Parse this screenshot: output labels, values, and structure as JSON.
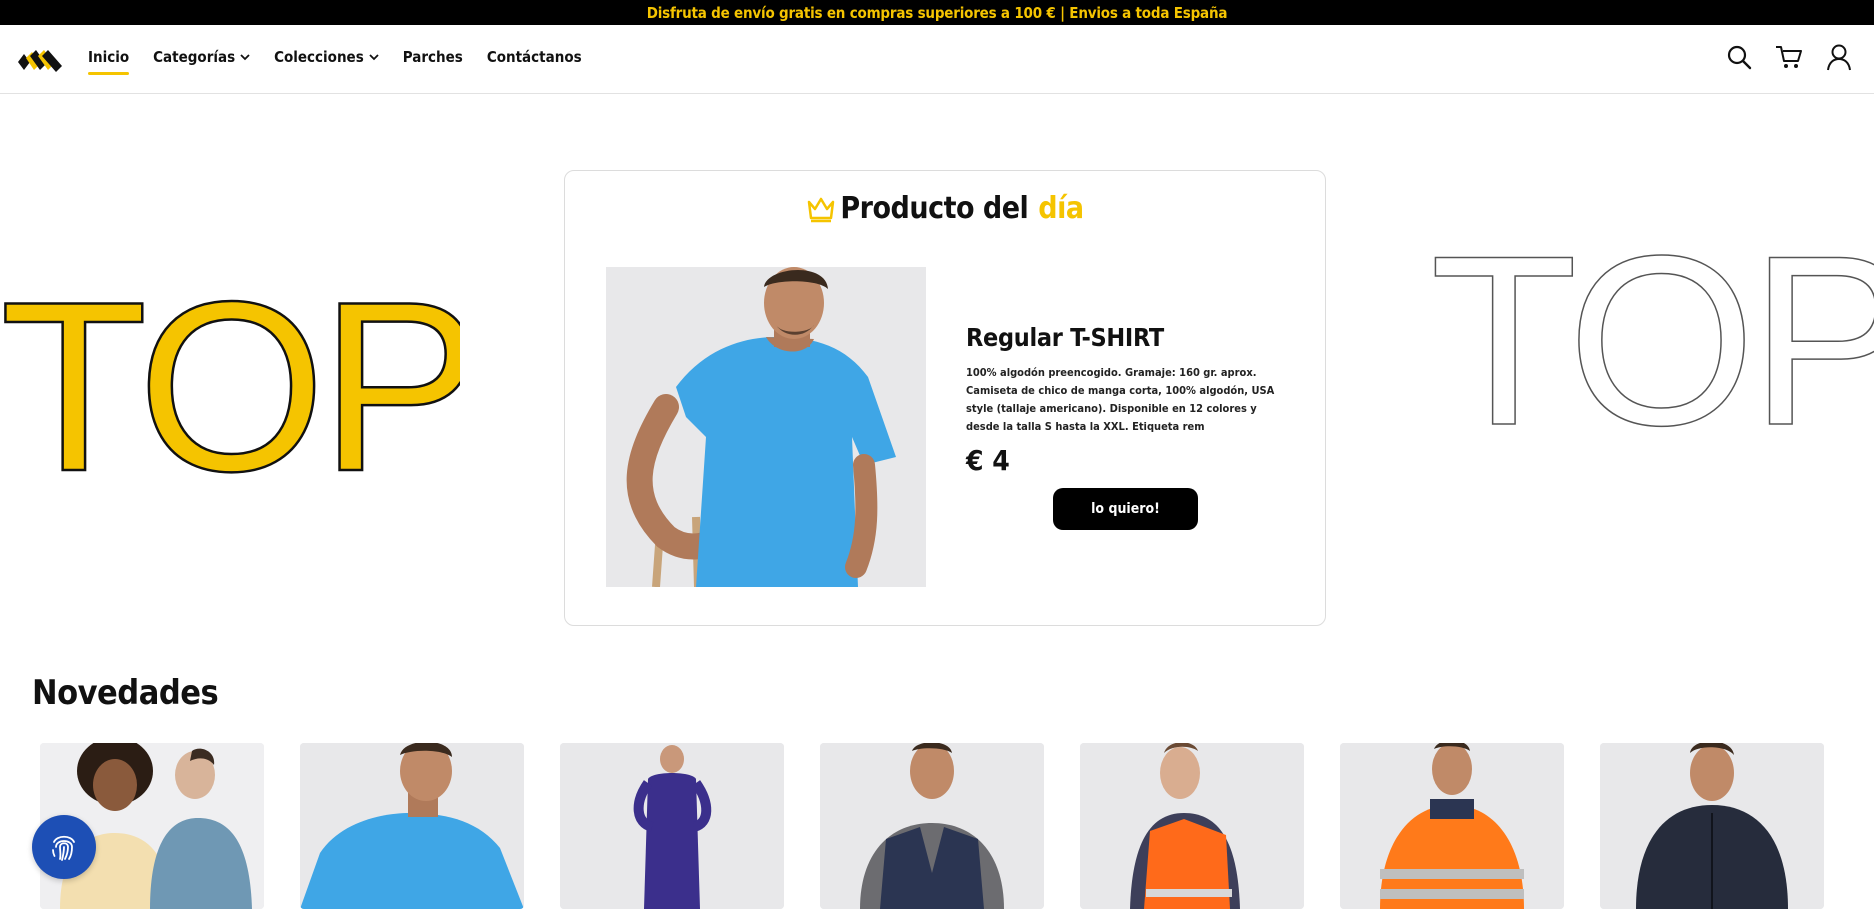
{
  "announcement": {
    "text": "Disfruta de envío gratis en compras superiores a 100 € | Envios a toda España"
  },
  "colors": {
    "accent": "#f5c400",
    "dark": "#000000",
    "fingerprint_button": "#1d4fb5"
  },
  "header": {
    "logo_icon": "brand-logo-icon",
    "nav": [
      {
        "label": "Inicio",
        "active": true
      },
      {
        "label": "Categorías",
        "dropdown": true
      },
      {
        "label": "Colecciones",
        "dropdown": true
      },
      {
        "label": "Parches"
      },
      {
        "label": "Contáctanos"
      }
    ],
    "icons": [
      "search-icon",
      "cart-icon",
      "user-icon"
    ]
  },
  "hero": {
    "left_word": "TOP",
    "right_word": "TOP"
  },
  "product_of_day": {
    "title_prefix": "Producto del",
    "title_highlight": "día",
    "crown_icon": "crown-icon",
    "name": "Regular T-SHIRT",
    "description": "100% algodón preencogido. Gramaje: 160 gr. aprox. Camiseta de chico de manga corta, 100% algodón, USA style (tallaje americano). Disponible en 12 colores y desde la talla S hasta la XXL. Etiqueta rem",
    "price": "€ 4",
    "button_label": "lo quiero!"
  },
  "novedades": {
    "title": "Novedades",
    "products": [
      {
        "image": "sweatshirts-couple"
      },
      {
        "image": "blue-tshirt"
      },
      {
        "image": "navy-coverall"
      },
      {
        "image": "navy-vest"
      },
      {
        "image": "orange-hivis-vest"
      },
      {
        "image": "orange-hivis-jacket"
      },
      {
        "image": "navy-softshell-jacket"
      }
    ]
  },
  "floating": {
    "fingerprint_icon": "fingerprint-icon"
  }
}
